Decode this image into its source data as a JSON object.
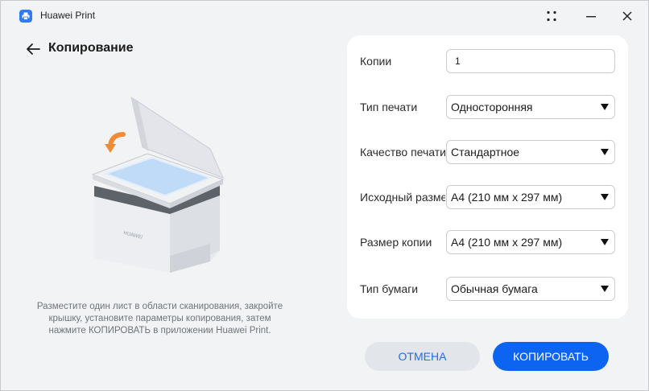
{
  "window": {
    "title": "Huawei Print",
    "controls": [
      "dots-grid-icon",
      "minimize-icon",
      "close-icon"
    ]
  },
  "header": {
    "title": "Копирование"
  },
  "illustration": {
    "hint": "Разместите один лист в области сканирования, закройте крышку, установите параметры копирования, затем нажмите КОПИРОВАТЬ в приложении Huawei Print."
  },
  "settings": {
    "copies": {
      "label": "Копии",
      "value": "1"
    },
    "print_type": {
      "label": "Тип печати",
      "value": "Односторонняя"
    },
    "quality": {
      "label": "Качество печати",
      "value": "Стандартное"
    },
    "source_size": {
      "label": "Исходный размер",
      "value": "A4 (210 мм x 297 мм)"
    },
    "copy_size": {
      "label": "Размер копии",
      "value": "A4 (210 мм x 297 мм)"
    },
    "paper_type": {
      "label": "Тип бумаги",
      "value": "Обычная бумага"
    }
  },
  "actions": {
    "cancel": "ОТМЕНА",
    "copy": "КОПИРОВАТЬ"
  },
  "colors": {
    "accent": "#0d64f0",
    "cancel_text": "#1f6fe5",
    "background": "#f1f3f5",
    "card": "#ffffff"
  }
}
